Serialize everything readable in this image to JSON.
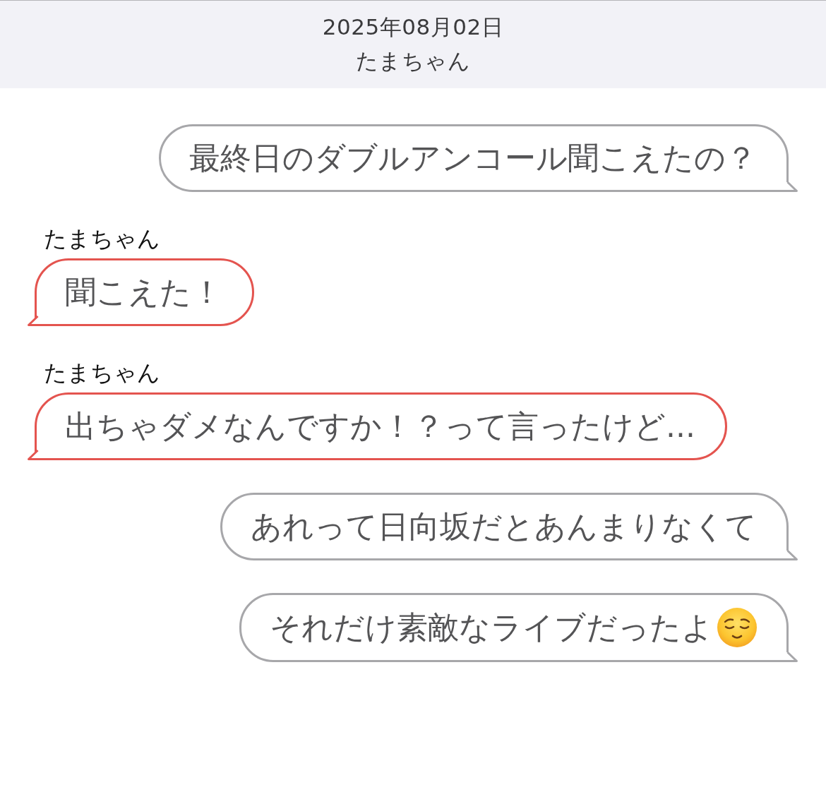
{
  "header": {
    "date": "2025年08月02日",
    "contact": "たまちゃん"
  },
  "messages": [
    {
      "kind": "sent",
      "text": "最終日のダブルアンコール聞こえたの？"
    },
    {
      "kind": "received",
      "sender": "たまちゃん",
      "text": "聞こえた！"
    },
    {
      "kind": "received",
      "sender": "たまちゃん",
      "text": "出ちゃダメなんですか！？って言ったけど..."
    },
    {
      "kind": "sent",
      "text": "あれって日向坂だとあんまりなくて"
    },
    {
      "kind": "sent",
      "text": "それだけ素敵なライブだったよ",
      "emoji": true
    }
  ]
}
